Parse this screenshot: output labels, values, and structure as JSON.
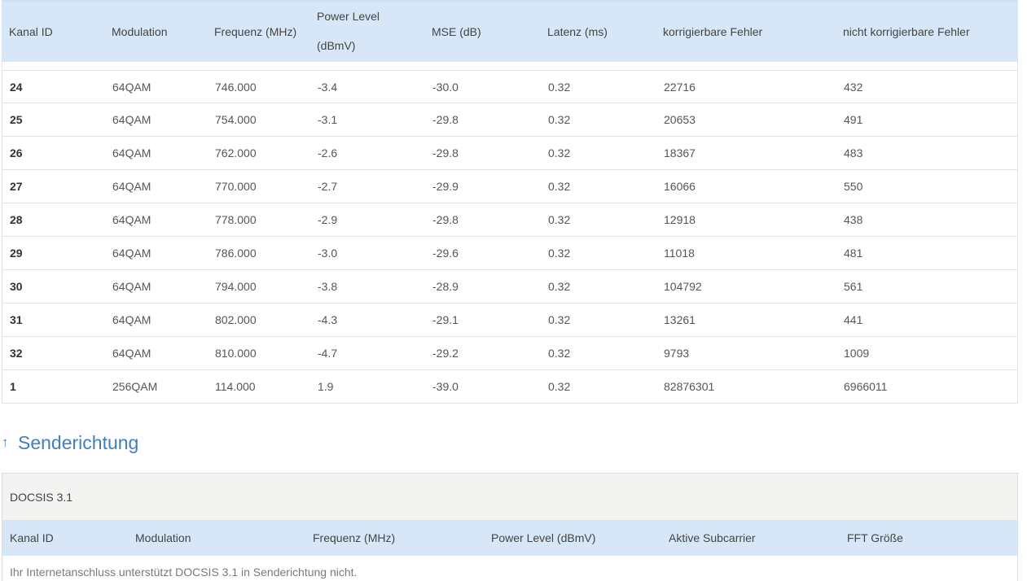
{
  "downstream": {
    "headers": {
      "kanal_id": "Kanal ID",
      "modulation": "Modulation",
      "frequenz": "Frequenz (MHz)",
      "power_level_1": "Power Level",
      "power_level_2": "(dBmV)",
      "mse": "MSE (dB)",
      "latenz": "Latenz (ms)",
      "korrigierbar": "korrigierbare Fehler",
      "nicht_korrigierbar": "nicht korrigierbare Fehler"
    },
    "rows": [
      {
        "id": "24",
        "modulation": "64QAM",
        "frequenz": "746.000",
        "power": "-3.4",
        "mse": "-30.0",
        "latenz": "0.32",
        "korr": "22716",
        "nkorr": "432"
      },
      {
        "id": "25",
        "modulation": "64QAM",
        "frequenz": "754.000",
        "power": "-3.1",
        "mse": "-29.8",
        "latenz": "0.32",
        "korr": "20653",
        "nkorr": "491"
      },
      {
        "id": "26",
        "modulation": "64QAM",
        "frequenz": "762.000",
        "power": "-2.6",
        "mse": "-29.8",
        "latenz": "0.32",
        "korr": "18367",
        "nkorr": "483"
      },
      {
        "id": "27",
        "modulation": "64QAM",
        "frequenz": "770.000",
        "power": "-2.7",
        "mse": "-29.9",
        "latenz": "0.32",
        "korr": "16066",
        "nkorr": "550"
      },
      {
        "id": "28",
        "modulation": "64QAM",
        "frequenz": "778.000",
        "power": "-2.9",
        "mse": "-29.8",
        "latenz": "0.32",
        "korr": "12918",
        "nkorr": "438"
      },
      {
        "id": "29",
        "modulation": "64QAM",
        "frequenz": "786.000",
        "power": "-3.0",
        "mse": "-29.6",
        "latenz": "0.32",
        "korr": "11018",
        "nkorr": "481"
      },
      {
        "id": "30",
        "modulation": "64QAM",
        "frequenz": "794.000",
        "power": "-3.8",
        "mse": "-28.9",
        "latenz": "0.32",
        "korr": "104792",
        "nkorr": "561"
      },
      {
        "id": "31",
        "modulation": "64QAM",
        "frequenz": "802.000",
        "power": "-4.3",
        "mse": "-29.1",
        "latenz": "0.32",
        "korr": "13261",
        "nkorr": "441"
      },
      {
        "id": "32",
        "modulation": "64QAM",
        "frequenz": "810.000",
        "power": "-4.7",
        "mse": "-29.2",
        "latenz": "0.32",
        "korr": "9793",
        "nkorr": "1009"
      },
      {
        "id": "1",
        "modulation": "256QAM",
        "frequenz": "114.000",
        "power": "1.9",
        "mse": "-39.0",
        "latenz": "0.32",
        "korr": "82876301",
        "nkorr": "6966011"
      }
    ]
  },
  "upstream": {
    "section_title": "Senderichtung",
    "arrow_icon": "arrow-up-icon",
    "docsis_label": "DOCSIS 3.1",
    "headers": {
      "kanal_id": "Kanal ID",
      "modulation": "Modulation",
      "frequenz": "Frequenz (MHz)",
      "power_level": "Power Level (dBmV)",
      "aktive_subcarrier": "Aktive Subcarrier",
      "fft": "FFT Größe"
    },
    "note": "Ihr Internetanschluss unterstützt DOCSIS 3.1 in Senderichtung nicht."
  },
  "colors": {
    "header_bg": "#d7e7f8",
    "accent": "#3f7fbf"
  }
}
